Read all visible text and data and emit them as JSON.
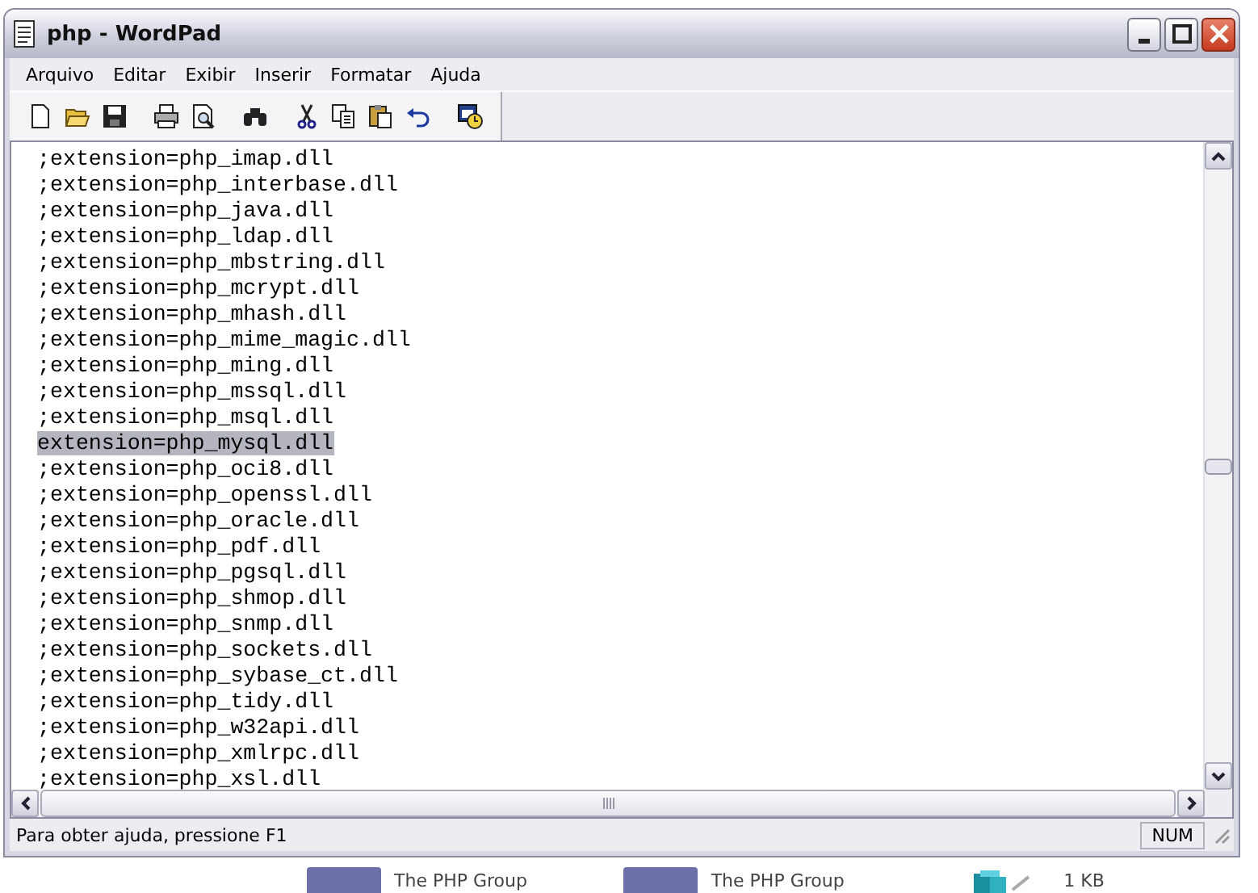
{
  "window": {
    "title": "php - WordPad"
  },
  "menu": [
    "Arquivo",
    "Editar",
    "Exibir",
    "Inserir",
    "Formatar",
    "Ajuda"
  ],
  "toolbar": [
    {
      "kind": "new"
    },
    {
      "kind": "open"
    },
    {
      "kind": "save"
    },
    {
      "kind": "sep"
    },
    {
      "kind": "print"
    },
    {
      "kind": "preview"
    },
    {
      "kind": "sep"
    },
    {
      "kind": "find"
    },
    {
      "kind": "sep"
    },
    {
      "kind": "cut"
    },
    {
      "kind": "copy"
    },
    {
      "kind": "paste"
    },
    {
      "kind": "undo"
    },
    {
      "kind": "sep"
    },
    {
      "kind": "datetime"
    }
  ],
  "document": {
    "lines": [
      {
        "text": ";extension=php_imap.dll",
        "selected": false
      },
      {
        "text": ";extension=php_interbase.dll",
        "selected": false
      },
      {
        "text": ";extension=php_java.dll",
        "selected": false
      },
      {
        "text": ";extension=php_ldap.dll",
        "selected": false
      },
      {
        "text": ";extension=php_mbstring.dll",
        "selected": false
      },
      {
        "text": ";extension=php_mcrypt.dll",
        "selected": false
      },
      {
        "text": ";extension=php_mhash.dll",
        "selected": false
      },
      {
        "text": ";extension=php_mime_magic.dll",
        "selected": false
      },
      {
        "text": ";extension=php_ming.dll",
        "selected": false
      },
      {
        "text": ";extension=php_mssql.dll",
        "selected": false
      },
      {
        "text": ";extension=php_msql.dll",
        "selected": false
      },
      {
        "text": "extension=php_mysql.dll",
        "selected": true
      },
      {
        "text": ";extension=php_oci8.dll",
        "selected": false
      },
      {
        "text": ";extension=php_openssl.dll",
        "selected": false
      },
      {
        "text": ";extension=php_oracle.dll",
        "selected": false
      },
      {
        "text": ";extension=php_pdf.dll",
        "selected": false
      },
      {
        "text": ";extension=php_pgsql.dll",
        "selected": false
      },
      {
        "text": ";extension=php_shmop.dll",
        "selected": false
      },
      {
        "text": ";extension=php_snmp.dll",
        "selected": false
      },
      {
        "text": ";extension=php_sockets.dll",
        "selected": false
      },
      {
        "text": ";extension=php_sybase_ct.dll",
        "selected": false
      },
      {
        "text": ";extension=php_tidy.dll",
        "selected": false
      },
      {
        "text": ";extension=php_w32api.dll",
        "selected": false
      },
      {
        "text": ";extension=php_xmlrpc.dll",
        "selected": false
      },
      {
        "text": ";extension=php_xsl.dll",
        "selected": false
      }
    ]
  },
  "status_bar": {
    "help": "Para obter ajuda, pressione F1",
    "indicator": "NUM"
  },
  "background_files": [
    {
      "kind": "php",
      "publisher": "The PHP Group"
    },
    {
      "kind": "php",
      "publisher": "The PHP Group"
    },
    {
      "kind": "reg",
      "size": "1 KB"
    }
  ]
}
